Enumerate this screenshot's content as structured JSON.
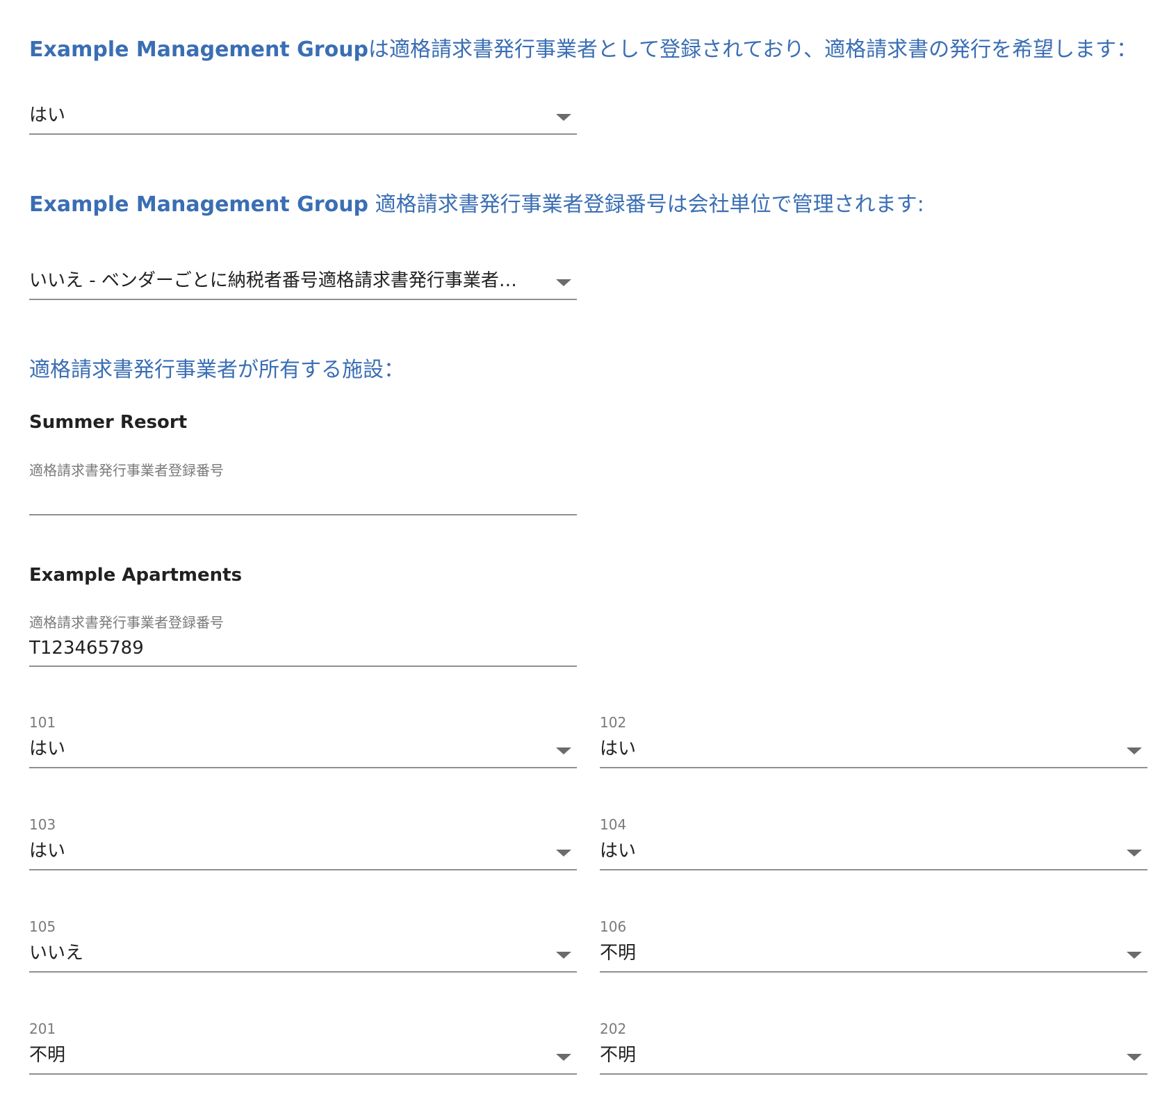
{
  "q1": {
    "brand": "Example Management Group",
    "text": "は適格請求書発行事業者として登録されており、適格請求書の発行を希望します：",
    "value": "はい"
  },
  "q2": {
    "brand": "Example Management Group",
    "text": " 適格請求書発行事業者登録番号は会社単位で管理されます:",
    "value": "いいえ - ベンダーごとに納税者番号適格請求書発行事業者…"
  },
  "q3": {
    "text": "適格請求書発行事業者が所有する施設："
  },
  "properties": [
    {
      "name": "Summer Resort",
      "field_label": "適格請求書発行事業者登録番号",
      "value": ""
    },
    {
      "name": "Example Apartments",
      "field_label": "適格請求書発行事業者登録番号",
      "value": "T123465789"
    }
  ],
  "units": [
    {
      "label": "101",
      "value": "はい"
    },
    {
      "label": "102",
      "value": "はい"
    },
    {
      "label": "103",
      "value": "はい"
    },
    {
      "label": "104",
      "value": "はい"
    },
    {
      "label": "105",
      "value": "いいえ"
    },
    {
      "label": "106",
      "value": "不明"
    },
    {
      "label": "201",
      "value": "不明"
    },
    {
      "label": "202",
      "value": "不明"
    }
  ],
  "colors": {
    "heading": "#3a6eb4",
    "text": "#212121",
    "label": "#7a7a7a",
    "underline": "#8f8f8f"
  },
  "icons": {
    "dropdown": "chevron-down-icon"
  }
}
